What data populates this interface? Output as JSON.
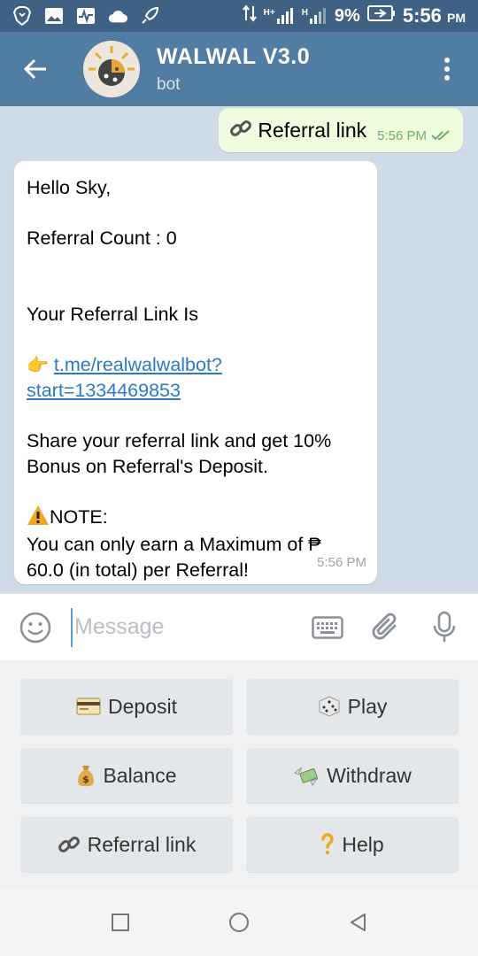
{
  "status_bar": {
    "battery_text": "9%",
    "time": "5:56",
    "time_suffix": "PM",
    "network_h1": "H+",
    "network_h2": "H"
  },
  "header": {
    "title": "WALWAL V3.0",
    "subtitle": "bot"
  },
  "chat": {
    "outgoing": {
      "icon": "link-emoji",
      "text": "Referral link",
      "time": "5:56 PM",
      "status": "read-double-check"
    },
    "incoming": {
      "greeting": "Hello Sky,",
      "count_line": "Referral Count : 0",
      "link_intro": "Your Referral Link Is",
      "link_pointer": "👉",
      "link_line1": "t.me/realwalwalbot?",
      "link_line2": "start=1334469853",
      "share_line1": "Share your referral link and get 10%",
      "share_line2": "Bonus on Referral's Deposit.",
      "note_label": "NOTE:",
      "note_line1": "You can only earn a Maximum of ₱",
      "note_line2": "60.0 (in total) per Referral!",
      "time": "5:56 PM"
    }
  },
  "input": {
    "placeholder": "Message"
  },
  "bot_keyboard": {
    "buttons": [
      {
        "label": "Deposit",
        "icon": "credit-card-icon"
      },
      {
        "label": "Play",
        "icon": "dice-icon"
      },
      {
        "label": "Balance",
        "icon": "money-bag-icon"
      },
      {
        "label": "Withdraw",
        "icon": "money-wings-icon"
      },
      {
        "label": "Referral link",
        "icon": "link-icon"
      },
      {
        "label": "Help",
        "icon": "question-mark-icon"
      }
    ]
  },
  "colors": {
    "status_bar": "#3f6184",
    "header": "#527da3",
    "chat_bg": "#cfdbe6",
    "outgoing_bubble": "#effdde",
    "link": "#2b79c3"
  }
}
